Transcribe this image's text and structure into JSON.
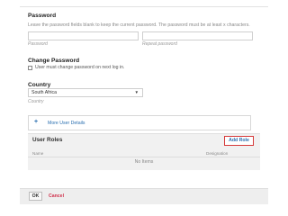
{
  "password": {
    "title": "Password",
    "hint": "Leave the password fields blank to keep the current password. The password must be at least x characters.",
    "password_caption": "Password",
    "repeat_caption": "Repeat password"
  },
  "change_password": {
    "title": "Change Password",
    "checkbox_label": "User must change password on next log in."
  },
  "country": {
    "title": "Country",
    "selected": "South Africa",
    "caption": "Country"
  },
  "more_details": {
    "label": "More User Details"
  },
  "user_roles": {
    "title": "User Roles",
    "add_role_label": "Add Role",
    "columns": [
      "Name",
      "Designation"
    ],
    "empty_text": "No Items"
  },
  "footer": {
    "ok_label": "OK",
    "cancel_label": "Cancel"
  },
  "icons": {
    "plus": "plus-icon",
    "dropdown": "chevron-down-icon"
  },
  "colors": {
    "link": "#2a6fb0",
    "cancel": "#d0304b",
    "highlight_border": "#d63b3b"
  }
}
